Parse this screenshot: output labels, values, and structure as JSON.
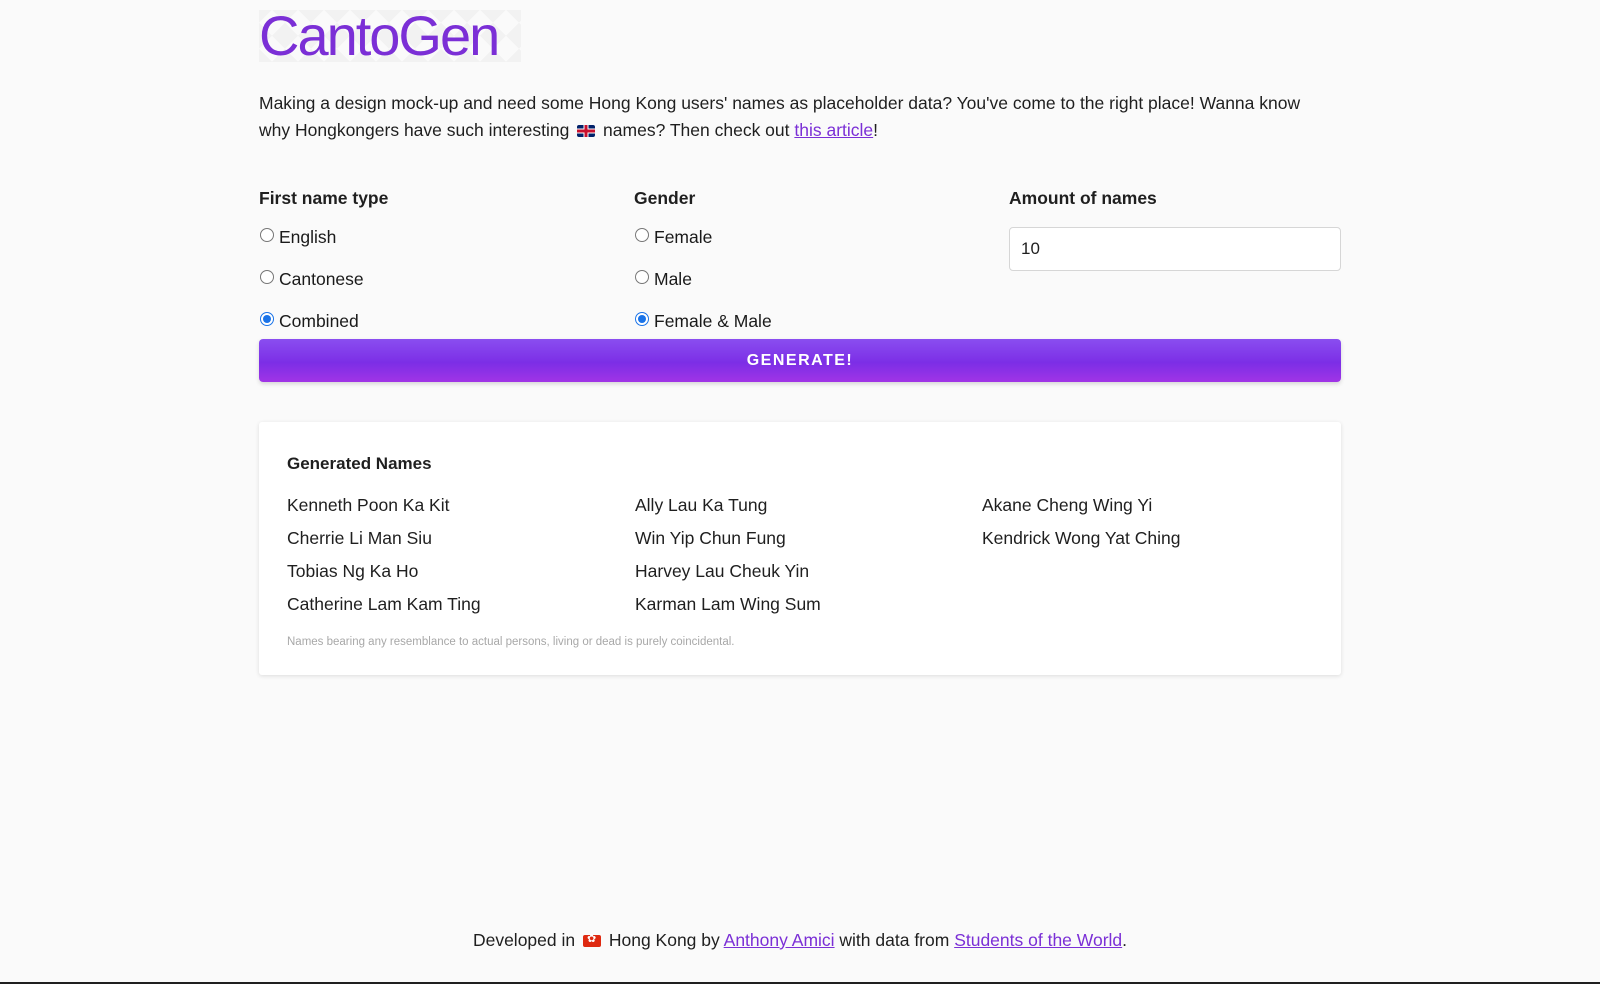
{
  "header": {
    "logo": "CantoGen"
  },
  "intro": {
    "text_1": "Making a design mock-up and need some Hong Kong users' names as placeholder data? You've come to the right place! Wanna know why Hongkongers have such interesting ",
    "flag_uk": "uk-flag-icon",
    "text_2": " names? Then check out ",
    "link": "this article",
    "text_3": "!"
  },
  "form": {
    "first_name_type": {
      "title": "First name type",
      "options": [
        "English",
        "Cantonese",
        "Combined"
      ],
      "selected": "Combined"
    },
    "gender": {
      "title": "Gender",
      "options": [
        "Female",
        "Male",
        "Female & Male"
      ],
      "selected": "Female & Male"
    },
    "amount": {
      "title": "Amount of names",
      "value": "10"
    },
    "generate_label": "GENERATE!"
  },
  "results": {
    "title": "Generated Names",
    "names": [
      "Kenneth Poon Ka Kit",
      "Cherrie Li Man Siu",
      "Tobias Ng Ka Ho",
      "Catherine Lam Kam Ting",
      "Ally Lau Ka Tung",
      "Win Yip Chun Fung",
      "Harvey Lau Cheuk Yin",
      "Karman Lam Wing Sum",
      "Akane Cheng Wing Yi",
      "Kendrick Wong Yat Ching"
    ],
    "disclaimer": "Names bearing any resemblance to actual persons, living or dead is purely coincidental."
  },
  "footer": {
    "text_1": "Developed in ",
    "flag_hk": "hong-kong-flag-icon",
    "text_2": " Hong Kong by ",
    "author_link": "Anthony Amici",
    "text_3": " with data from ",
    "data_link": "Students of the World",
    "text_4": "."
  },
  "colors": {
    "accent": "#7b2fd6",
    "button_gradient_start": "#8a4ef0",
    "button_gradient_end": "#a034e6",
    "radio_checked": "#1a73e8"
  }
}
